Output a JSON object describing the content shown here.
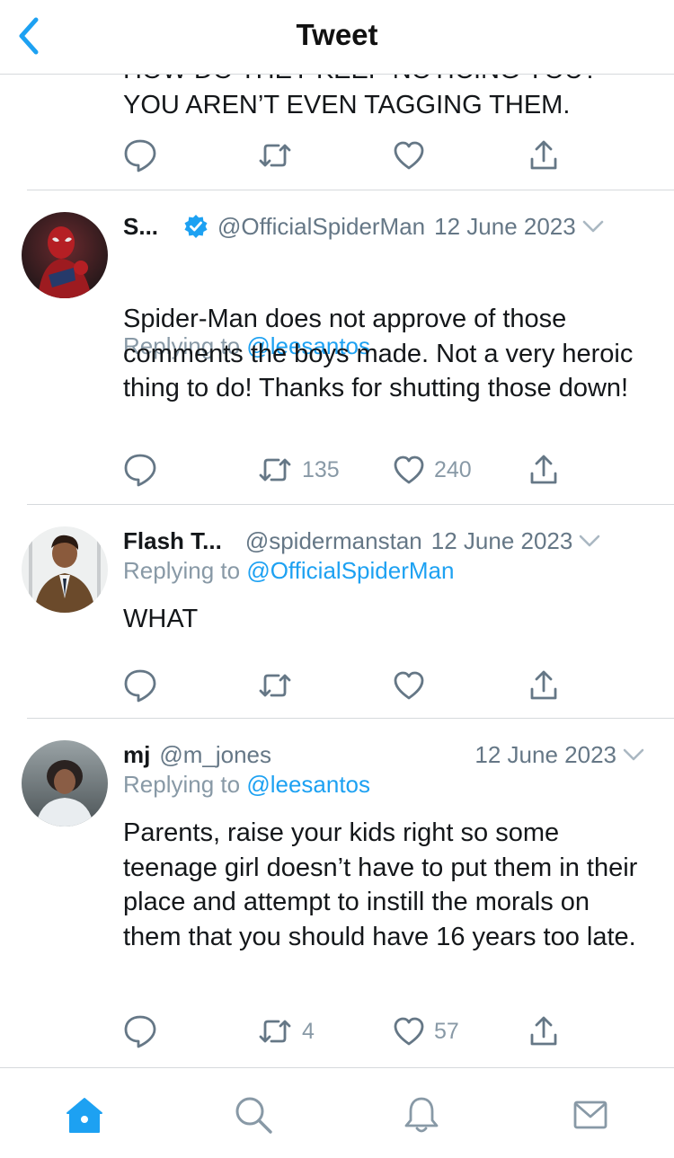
{
  "topbar": {
    "title": "Tweet"
  },
  "previous_tweet": {
    "text_line_1": "HOW DO THEY KEEP NOTICING YOU?",
    "text_line_2": "YOU AREN’T EVEN TAGGING THEM."
  },
  "tweets": [
    {
      "name": "S...",
      "verified": true,
      "handle": "@OfficialSpiderMan",
      "date": "12 June 2023",
      "replying_prefix": "Replying to",
      "replying_to": "@leesantos",
      "text": "Spider-Man does not approve of those comments the boys made. Not a very heroic thing to do! Thanks for shutting those down!",
      "retweets": "135",
      "likes": "240"
    },
    {
      "name": "Flash T...",
      "verified": false,
      "handle": "@spidermanstan",
      "date": "12 June 2023",
      "replying_prefix": "Replying to",
      "replying_to": "@OfficialSpiderMan",
      "text": "WHAT",
      "retweets": "",
      "likes": ""
    },
    {
      "name": "mj",
      "verified": false,
      "handle": "@m_jones",
      "date": "12 June 2023",
      "replying_prefix": "Replying to",
      "replying_to": "@leesantos",
      "text": "Parents, raise your kids right so some teenage girl doesn’t have to put them in their place and attempt to instill the morals on them that you should have 16 years too late.",
      "retweets": "4",
      "likes": "57"
    }
  ],
  "tabs": [
    "home-icon",
    "search-icon",
    "notifications-icon",
    "messages-icon"
  ],
  "colors": {
    "accent": "#1da1f2",
    "icon_gray": "#657786",
    "divider": "#d6d9dc"
  }
}
